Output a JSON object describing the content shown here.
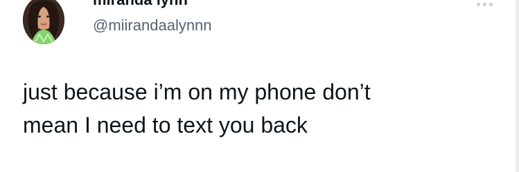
{
  "tweet": {
    "author": {
      "display_name": "miranda lynn",
      "handle": "@miirandaalynnn",
      "avatar_icon": "profile-photo"
    },
    "menu_icon": "more-icon",
    "text_lines": [
      "just because i’m on my phone don’t",
      "mean I need to text you back"
    ],
    "colors": {
      "background": "#ffffff",
      "text": "#0f1419",
      "handle": "#536471",
      "menu_dots": "#c9ced3"
    }
  }
}
